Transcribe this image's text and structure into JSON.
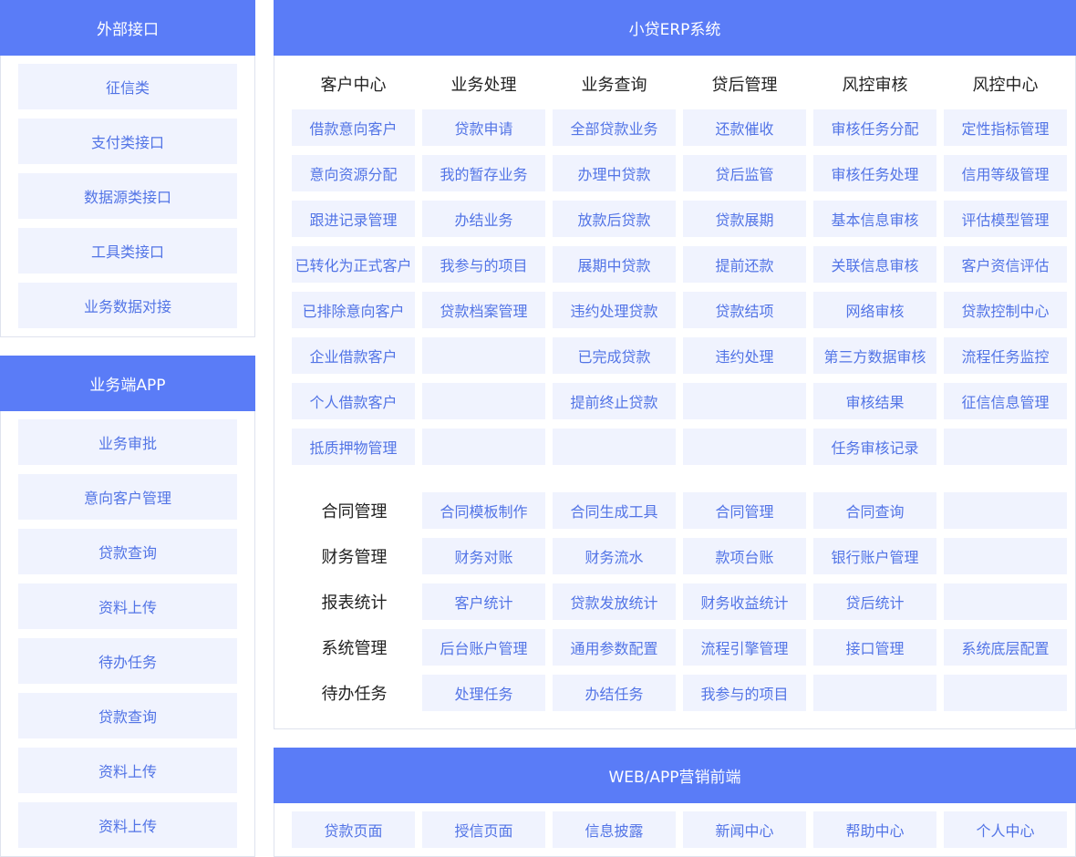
{
  "external": {
    "title": "外部接口",
    "items": [
      "征信类",
      "支付类接口",
      "数据源类接口",
      "工具类接口",
      "业务数据对接"
    ]
  },
  "app": {
    "title": "业务端APP",
    "items": [
      "业务审批",
      "意向客户管理",
      "贷款查询",
      "资料上传",
      "待办任务",
      "贷款查询",
      "资料上传",
      "资料上传"
    ]
  },
  "erp": {
    "title": "小贷ERP系统",
    "columns": [
      {
        "title": "客户中心",
        "items": [
          "借款意向客户",
          "意向资源分配",
          "跟进记录管理",
          "已转化为正式客户",
          "已排除意向客户",
          "企业借款客户",
          "个人借款客户",
          "抵质押物管理"
        ]
      },
      {
        "title": "业务处理",
        "items": [
          "贷款申请",
          "我的暂存业务",
          "办结业务",
          "我参与的项目",
          "贷款档案管理",
          "",
          "",
          ""
        ]
      },
      {
        "title": "业务查询",
        "items": [
          "全部贷款业务",
          "办理中贷款",
          "放款后贷款",
          "展期中贷款",
          "违约处理贷款",
          "已完成贷款",
          "提前终止贷款",
          ""
        ]
      },
      {
        "title": "贷后管理",
        "items": [
          "还款催收",
          "贷后监管",
          "贷款展期",
          "提前还款",
          "贷款结项",
          "违约处理",
          "",
          ""
        ]
      },
      {
        "title": "风控审核",
        "items": [
          "审核任务分配",
          "审核任务处理",
          "基本信息审核",
          "关联信息审核",
          "网络审核",
          "第三方数据审核",
          "审核结果",
          "任务审核记录"
        ]
      },
      {
        "title": "风控中心",
        "items": [
          "定性指标管理",
          "信用等级管理",
          "评估模型管理",
          "客户资信评估",
          "贷款控制中心",
          "流程任务监控",
          "征信信息管理",
          ""
        ]
      }
    ],
    "rows": [
      {
        "title": "合同管理",
        "items": [
          "合同模板制作",
          "合同生成工具",
          "合同管理",
          "合同查询",
          ""
        ]
      },
      {
        "title": "财务管理",
        "items": [
          "财务对账",
          "财务流水",
          "款项台账",
          "银行账户管理",
          ""
        ]
      },
      {
        "title": "报表统计",
        "items": [
          "客户统计",
          "贷款发放统计",
          "财务收益统计",
          "贷后统计",
          ""
        ]
      },
      {
        "title": "系统管理",
        "items": [
          "后台账户管理",
          "通用参数配置",
          "流程引擎管理",
          "接口管理",
          "系统底层配置"
        ]
      },
      {
        "title": "待办任务",
        "items": [
          "处理任务",
          "办结任务",
          "我参与的项目",
          "",
          ""
        ]
      }
    ]
  },
  "web": {
    "title": "WEB/APP营销前端",
    "items": [
      "贷款页面",
      "授信页面",
      "信息披露",
      "新闻中心",
      "帮助中心",
      "个人中心"
    ]
  }
}
